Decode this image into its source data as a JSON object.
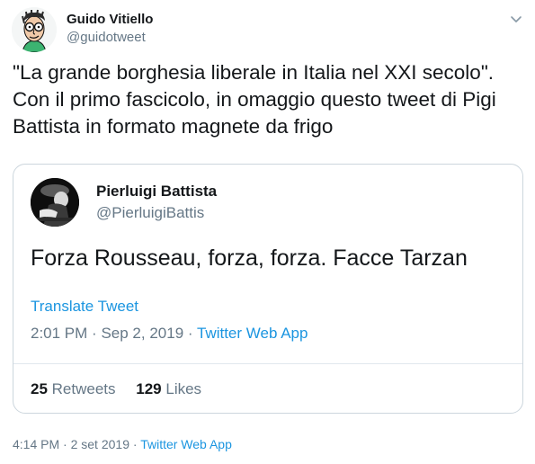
{
  "author": {
    "name": "Guido Vitiello",
    "handle": "@guidotweet"
  },
  "tweet": {
    "text": "\"La grande borghesia liberale in Italia nel XXI secolo\". Con il primo fascicolo, in omaggio questo tweet di Pigi Battista in formato magnete da frigo"
  },
  "quoted": {
    "name": "Pierluigi Battista",
    "handle": "@PierluigiBattis",
    "text": "Forza Rousseau, forza, forza. Facce Tarzan",
    "translate_label": "Translate Tweet",
    "time": "2:01 PM",
    "date": "Sep 2, 2019",
    "separator": "·",
    "source": "Twitter Web App",
    "retweets_count": "25",
    "retweets_label": "Retweets",
    "likes_count": "129",
    "likes_label": "Likes"
  },
  "footer": {
    "time": "4:14 PM",
    "date": "2 set 2019",
    "separator": "·",
    "source": "Twitter Web App"
  },
  "icons": {
    "caret": "chevron-down-icon"
  },
  "colors": {
    "link": "#1b95e0",
    "muted": "#657786",
    "text": "#14171a",
    "border": "#ccd6dd"
  }
}
